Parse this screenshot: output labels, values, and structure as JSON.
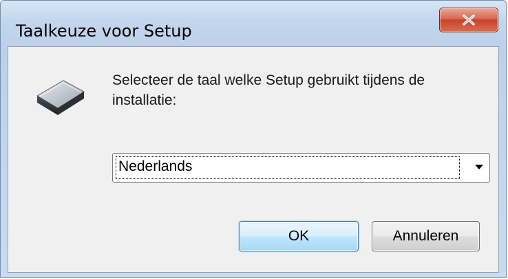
{
  "window": {
    "title": "Taalkeuze voor Setup",
    "close_icon": "close-x-icon"
  },
  "dialog": {
    "icon": "setup-drive-icon",
    "prompt": "Selecteer de taal welke Setup gebruikt tijdens de installatie:",
    "language_select": {
      "selected": "Nederlands",
      "arrow_icon": "dropdown-arrow-icon"
    },
    "buttons": {
      "ok_label": "OK",
      "cancel_label": "Annuleren"
    }
  },
  "colors": {
    "titlebar": "#c2d6ec",
    "client_bg": "#f0f0f0",
    "close_button": "#c8432a",
    "default_button_border": "#3c7fb1"
  }
}
